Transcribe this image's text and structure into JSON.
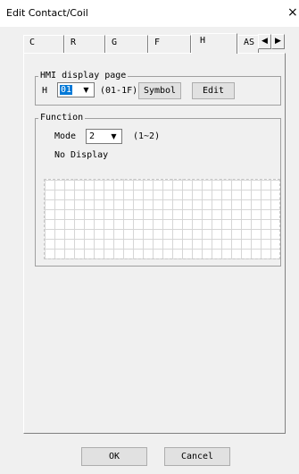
{
  "window": {
    "title": "Edit Contact/Coil",
    "close": "×"
  },
  "tabs": [
    {
      "label": "C"
    },
    {
      "label": "R"
    },
    {
      "label": "G"
    },
    {
      "label": "F"
    },
    {
      "label": "H",
      "active": true
    },
    {
      "label": "AS"
    }
  ],
  "tab_scroll": {
    "left": "◀",
    "right": "▶"
  },
  "hmi": {
    "group_label": "HMI display page",
    "prefix": "H",
    "page_value": "01",
    "range": "(01-1F)",
    "symbol_button": "Symbol",
    "edit_button": "Edit"
  },
  "function": {
    "group_label": "Function",
    "mode_label": "Mode",
    "mode_value": "2",
    "mode_range": "(1~2)",
    "status": "No Display"
  },
  "footer": {
    "ok": "OK",
    "cancel": "Cancel"
  },
  "colors": {
    "selection": "#0078d7",
    "background": "#f0f0f0"
  }
}
